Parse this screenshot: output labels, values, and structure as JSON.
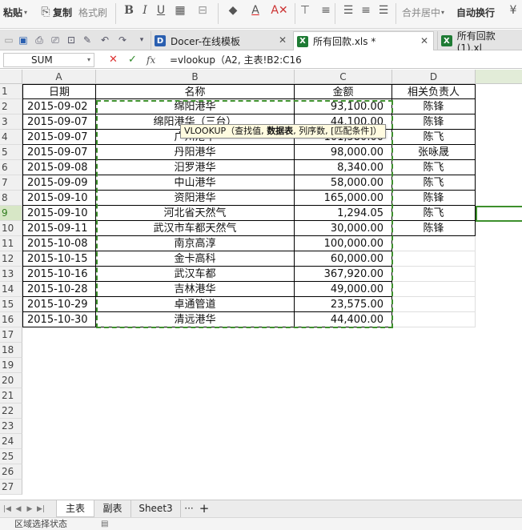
{
  "ribbon": {
    "paste": "粘贴",
    "copy": "复制",
    "format_painter": "格式刷",
    "bold": "B",
    "italic": "I",
    "underline": "U",
    "merge_center": "合并居中",
    "auto_wrap": "自动换行"
  },
  "tabs": [
    {
      "label": "Docer-在线模板"
    },
    {
      "label": "所有回款.xls *"
    },
    {
      "label": "所有回款 (1).xl"
    }
  ],
  "formula_bar": {
    "name_box": "SUM",
    "cancel": "✕",
    "confirm": "✓",
    "fx": "fx",
    "formula": "=vlookup（A2, 主表!B2:C16"
  },
  "tooltip": {
    "func": "VLOOKUP（查找值, ",
    "bold_arg": "数据表",
    "rest": ", 列序数, [匹配条件]）"
  },
  "columns": [
    "A",
    "B",
    "C",
    "D"
  ],
  "row_numbers": [
    "1",
    "2",
    "3",
    "4",
    "5",
    "6",
    "7",
    "8",
    "9",
    "10",
    "11",
    "12",
    "13",
    "14",
    "15",
    "16",
    "17",
    "18",
    "19",
    "20",
    "21",
    "22",
    "23",
    "24",
    "25",
    "26",
    "27"
  ],
  "header": {
    "date": "日期",
    "name": "名称",
    "amount": "金额",
    "owner": "相关负责人"
  },
  "rows": [
    {
      "date": "2015-09-02",
      "name": "绵阳港华",
      "amount": "93,100.00",
      "owner": "陈锋"
    },
    {
      "date": "2015-09-07",
      "name": "绵阳港华（三台）",
      "amount": "44,100.00",
      "owner": "陈锋"
    },
    {
      "date": "2015-09-07",
      "name": "广州港华",
      "amount": "101,580.00",
      "owner": "陈飞"
    },
    {
      "date": "2015-09-07",
      "name": "丹阳港华",
      "amount": "98,000.00",
      "owner": "张咏晟"
    },
    {
      "date": "2015-09-08",
      "name": "汨罗港华",
      "amount": "8,340.00",
      "owner": "陈飞"
    },
    {
      "date": "2015-09-09",
      "name": "中山港华",
      "amount": "58,000.00",
      "owner": "陈飞"
    },
    {
      "date": "2015-09-10",
      "name": "资阳港华",
      "amount": "165,000.00",
      "owner": "陈锋"
    },
    {
      "date": "2015-09-10",
      "name": "河北省天然气",
      "amount": "1,294.05",
      "owner": "陈飞"
    },
    {
      "date": "2015-09-11",
      "name": "武汉市车都天然气",
      "amount": "30,000.00",
      "owner": "陈锋"
    },
    {
      "date": "2015-10-08",
      "name": "南京高淳",
      "amount": "100,000.00",
      "owner": ""
    },
    {
      "date": "2015-10-15",
      "name": "金卡高科",
      "amount": "60,000.00",
      "owner": ""
    },
    {
      "date": "2015-10-16",
      "name": "武汉车都",
      "amount": "367,920.00",
      "owner": ""
    },
    {
      "date": "2015-10-28",
      "name": "吉林港华",
      "amount": "49,000.00",
      "owner": ""
    },
    {
      "date": "2015-10-29",
      "name": "卓通管道",
      "amount": "23,575.00",
      "owner": ""
    },
    {
      "date": "2015-10-30",
      "name": "清远港华",
      "amount": "44,400.00",
      "owner": ""
    }
  ],
  "sheets": [
    {
      "label": "主表"
    },
    {
      "label": "副表"
    },
    {
      "label": "Sheet3"
    }
  ],
  "sheet_more": "···",
  "sheet_add": "+",
  "status": "区域选择状态",
  "colors": {
    "selection_green": "#3d8f2c",
    "excel_tab_icon": "#1e7b34",
    "docer_tab_icon": "#2a5fb0"
  }
}
